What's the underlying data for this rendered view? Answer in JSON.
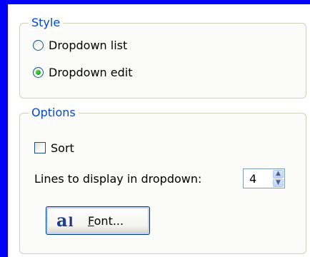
{
  "style_group": {
    "legend": "Style",
    "options": [
      {
        "label": "Dropdown list",
        "selected": false
      },
      {
        "label": "Dropdown edit",
        "selected": true
      }
    ]
  },
  "options_group": {
    "legend": "Options",
    "sort_label": "Sort",
    "sort_checked": false,
    "lines_label": "Lines to display in dropdown:",
    "lines_value": "4",
    "font_button": {
      "mnemonic": "F",
      "rest": "ont...",
      "icon": "font-icon"
    }
  },
  "colors": {
    "frame": "#0000ff",
    "legend_text": "#0046d5",
    "group_border": "#d0d0bf",
    "radio_dot": "#21a121"
  }
}
